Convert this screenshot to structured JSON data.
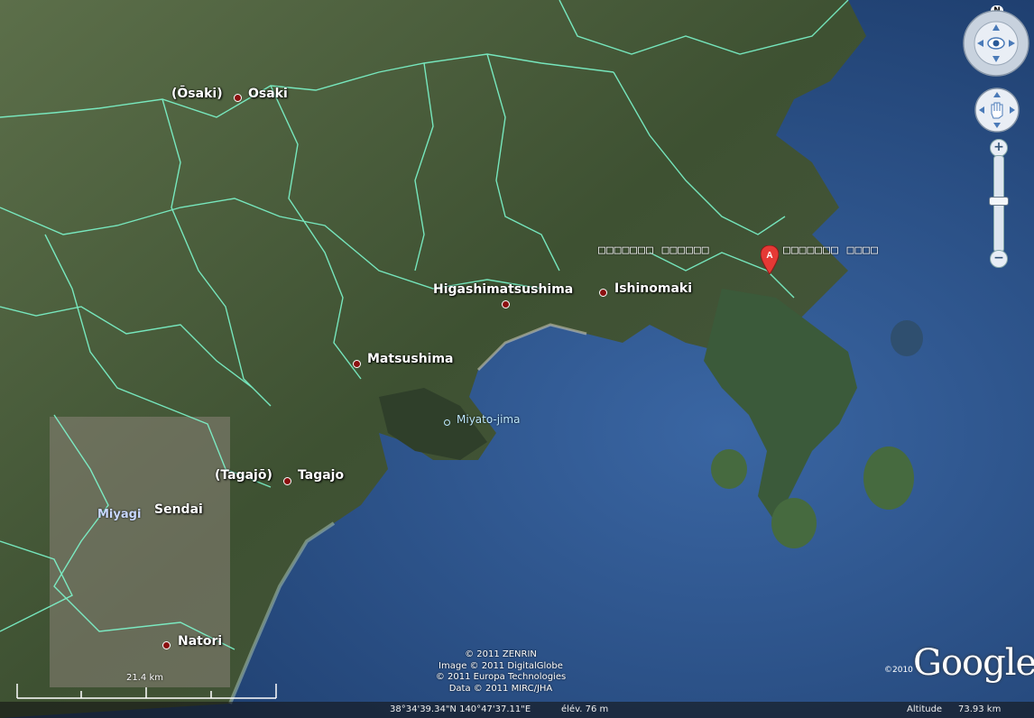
{
  "places": {
    "osaki_jp": "(Ōsaki)",
    "osaki": "Osaki",
    "higashimatsushima": "Higashimatsushima",
    "ishinomaki": "Ishinomaki",
    "matsushima": "Matsushima",
    "miyato_jima": "Miyato-jima",
    "tagajo_jp": "(Tagajō)",
    "tagajo": "Tagajo",
    "miyagi": "Miyagi",
    "sendai": "Sendai",
    "natori": "Natori"
  },
  "search_result": {
    "marker": "A",
    "label_left": "□□□□□□□ □□□□□□",
    "label_right": "□□□□□□□ □□□□"
  },
  "credits": {
    "line1": "© 2011 ZENRIN",
    "line2": "Image © 2011 DigitalGlobe",
    "line3": "© 2011 Europa Technologies",
    "line4": "Data © 2011 MIRC/JHA"
  },
  "scale": {
    "label": "21.4  km"
  },
  "logo": {
    "year": "©2010",
    "text": "Google"
  },
  "status": {
    "coords": "38°34'39.34\"N    140°47'37.11\"E",
    "elevation": "élév.   76 m",
    "altitude_label": "Altitude",
    "altitude_value": "73.93 km"
  },
  "controls": {
    "north_label": "N",
    "zoom_in": "+",
    "zoom_out": "−"
  },
  "colors": {
    "sea": "#2d5486",
    "land": "#3f5236",
    "boundary": "#7fffd4",
    "pin": "#e53935"
  }
}
